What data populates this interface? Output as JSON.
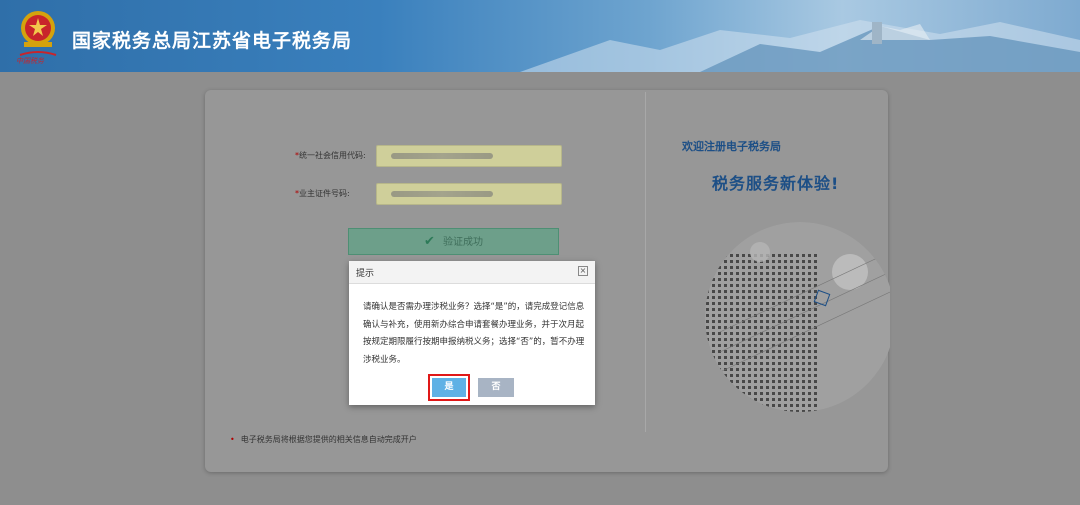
{
  "header": {
    "title": "国家税务总局江苏省电子税务局",
    "emblem_motto": "中国税务"
  },
  "form": {
    "credit_code_label": "统一社会信用代码:",
    "id_label": "业主证件号码:",
    "required_mark": "*",
    "verify_button": "验证成功",
    "note": "电子税务局将根据您提供的相关信息自动完成开户",
    "note_bullet": "•"
  },
  "welcome": {
    "title": "欢迎注册电子税务局",
    "slogan": "税务服务新体验!"
  },
  "modal": {
    "title": "提示",
    "close_label": "×",
    "message": "请确认是否需办理涉税业务？选择“是”的，请完成登记信息确认与补充，使用新办综合申请套餐办理业务，并于次月起按规定期限履行按期申报纳税义务；选择“否”的，暂不办理涉税业务。",
    "yes_label": "是",
    "no_label": "否"
  },
  "icons": {
    "check": "check-icon",
    "close": "close-icon",
    "emblem": "tax-emblem-icon"
  },
  "colors": {
    "header_blue": "#2f6fa9",
    "brand_text": "#1d4f86",
    "yes_button": "#5fb1e5",
    "no_button": "#a8b4c4",
    "highlight_border": "#e01818",
    "required": "#b00000"
  }
}
